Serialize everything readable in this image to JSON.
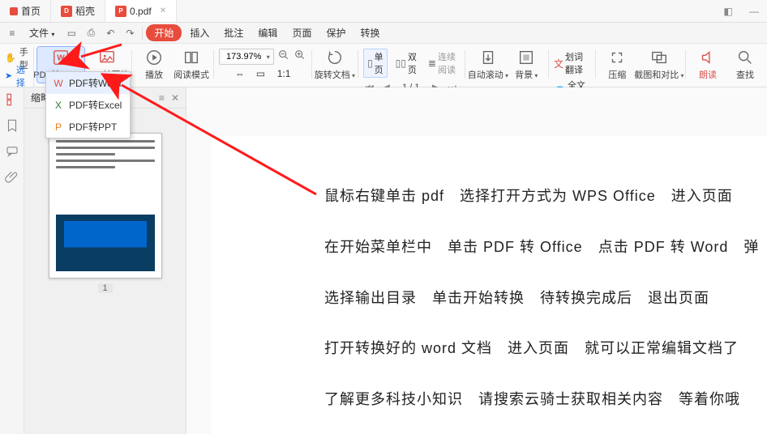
{
  "titlebar": {
    "tabs": [
      {
        "label": "首页",
        "icon": "home"
      },
      {
        "label": "稻壳",
        "icon": "docer"
      },
      {
        "label": "0.pdf",
        "icon": "pdf"
      }
    ]
  },
  "menubar": {
    "file": "文件",
    "items": [
      "开始",
      "插入",
      "批注",
      "编辑",
      "页面",
      "保护",
      "转换"
    ]
  },
  "leftcol": {
    "hand": "手型",
    "select": "选择"
  },
  "ribbon": {
    "pdf_to_office": "PDF转Office",
    "pdf_to_image": "PDF转图片",
    "play": "播放",
    "read_mode": "阅读模式",
    "zoom_value": "173.97%",
    "rotate": "旋转文档",
    "single_page": "单页",
    "double_page": "双页",
    "continuous": "连续阅读",
    "auto_scroll": "自动滚动",
    "background": "背景",
    "word_translate": "划词翻译",
    "full_translate": "全文翻译",
    "compress": "压缩",
    "compare": "截图和对比",
    "read_aloud": "朗读",
    "find": "查找",
    "page_current": "1",
    "page_total": "1"
  },
  "dropdown": {
    "items": [
      "PDF转Word",
      "PDF转Excel",
      "PDF转PPT"
    ]
  },
  "thumbpanel": {
    "title": "缩略图",
    "page_number": "1"
  },
  "document": {
    "lines": [
      "鼠标右键单击 pdf　选择打开方式为 WPS Office　进入页面",
      "在开始菜单栏中　单击 PDF 转 Office　点击 PDF 转 Word　弹",
      "选择输出目录　单击开始转换　待转换完成后　退出页面",
      "打开转换好的 word 文档　进入页面　就可以正常编辑文档了",
      "了解更多科技小知识　请搜索云骑士获取相关内容　等着你哦"
    ]
  }
}
